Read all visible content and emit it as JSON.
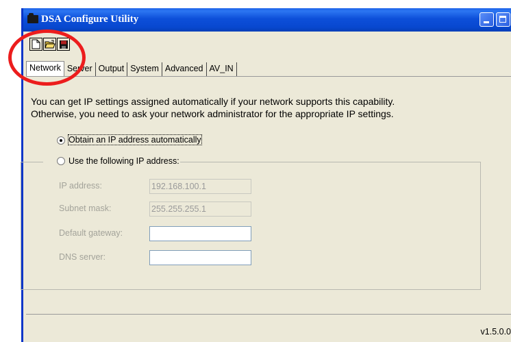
{
  "window": {
    "title": "DSA Configure Utility"
  },
  "toolbar": {
    "new_icon": "new-document-icon",
    "open_icon": "open-folder-icon",
    "save_icon": "save-disk-icon"
  },
  "tabs": [
    {
      "label": "Network",
      "active": true
    },
    {
      "label": "Server",
      "active": false
    },
    {
      "label": "Output",
      "active": false
    },
    {
      "label": "System",
      "active": false
    },
    {
      "label": "Advanced",
      "active": false
    },
    {
      "label": "AV_IN",
      "active": false
    }
  ],
  "network": {
    "info_line1": "You can get IP settings assigned automatically if your network supports this capability.",
    "info_line2": "Otherwise, you need to ask your network administrator for the appropriate IP settings.",
    "radio_auto": "Obtain an IP address automatically",
    "radio_manual": "Use the following IP address:",
    "auto_selected": true,
    "fields": [
      {
        "label": "IP address:",
        "value": "192.168.100.1"
      },
      {
        "label": "Subnet mask:",
        "value": "255.255.255.1"
      },
      {
        "label": "Default gateway:",
        "value": ""
      },
      {
        "label": "DNS server:",
        "value": ""
      }
    ]
  },
  "status": {
    "version": "v1.5.0.0"
  },
  "colors": {
    "titlebar": "#0848d0",
    "annotation_circle": "#ec1d1d",
    "window_face": "#ece9d8"
  }
}
